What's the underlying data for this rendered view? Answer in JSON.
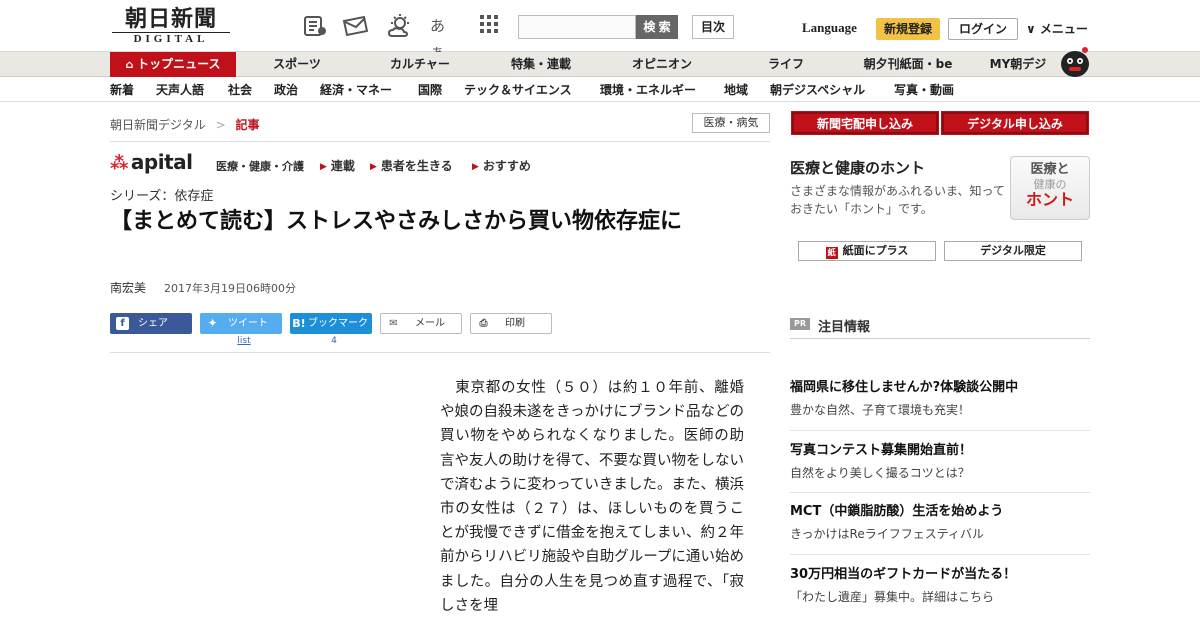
{
  "header": {
    "logo_top": "朝日新聞",
    "logo_bottom": "DIGITAL",
    "icons": [
      "newspaper-icon",
      "mail-icon",
      "weather-icon",
      "font-size-icon",
      "grid-menu-icon"
    ],
    "font_label": "あぁ",
    "search_placeholder": "",
    "search_button": "検 索",
    "toc_button": "目次",
    "language": "Language",
    "register": "新規登録",
    "login": "ログイン",
    "menu": "∨ メニュー"
  },
  "nav_primary": [
    "トップニュース",
    "スポーツ",
    "カルチャー",
    "特集・連載",
    "オピニオン",
    "ライフ",
    "朝夕刊紙面・be",
    "MY朝デジ"
  ],
  "nav_secondary": [
    "新着",
    "天声人語",
    "社会",
    "政治",
    "経済・マネー",
    "国際",
    "テック＆サイエンス",
    "環境・エネルギー",
    "地域",
    "朝デジスペシャル",
    "写真・動画"
  ],
  "breadcrumb": {
    "home": "朝日新聞デジタル",
    "sep": ">",
    "current": "記事"
  },
  "category": "医療・病気",
  "apital": {
    "logo": "apital",
    "subtitle": "医療・健康・介護",
    "links": [
      "連載",
      "患者を生きる",
      "おすすめ"
    ]
  },
  "article": {
    "series": "シリーズ：依存症",
    "title": "【まとめて読む】ストレスやさみしさから買い物依存症に",
    "author": "南宏美",
    "date": "2017年3月19日06時00分",
    "body": "　東京都の女性（５０）は約１０年前、離婚や娘の自殺未遂をきっかけにブランド品などの買い物をやめられなくなりました。医師の助言や友人の助けを得て、不要な買い物をしないで済むように変わっていきました。また、横浜市の女性は（２７）は、ほしいものを買うことが我慢できずに借金を抱えてしまい、約２年前からリハビリ施設や自助グループに通い始めました。自分の人生を見つめ直す過程で、「寂しさを埋"
  },
  "share": {
    "facebook": "シェア",
    "twitter": "ツイート",
    "hatena": "ブックマーク",
    "mail": "メール",
    "print": "印刷",
    "twitter_count": "list",
    "hatena_count": "4"
  },
  "sidebar": {
    "subscribe_paper": "新聞宅配申し込み",
    "subscribe_digital": "デジタル申し込み",
    "honto_title": "医療と健康のホント",
    "honto_desc": "さまざまな情報があふれるいま、知っておきたい「ホント」です。",
    "honto_img": {
      "line1": "医療と",
      "line2": "健康の",
      "line3": "ホント"
    },
    "btn_plus": "紙面にプラス",
    "btn_digital": "デジタル限定",
    "pr_tag": "PR",
    "pr_title": "注目情報",
    "ads": [
      {
        "title": "福岡県に移住しませんか?体験談公開中",
        "sub": "豊かな自然、子育て環境も充実！"
      },
      {
        "title": "写真コンテスト募集開始直前！",
        "sub": "自然をより美しく撮るコツとは？"
      },
      {
        "title": "MCT（中鎖脂肪酸）生活を始めよう",
        "sub": "きっかけはReライフフェスティバル"
      },
      {
        "title": "30万円相当のギフトカードが当たる！",
        "sub": "「わたし遺産」募集中。詳細はこちら"
      }
    ]
  },
  "colors": {
    "brand_red": "#c0111a",
    "register_yellow": "#f2c244",
    "facebook": "#3b5998",
    "twitter": "#55acee",
    "hatena": "#1d8fd7"
  }
}
